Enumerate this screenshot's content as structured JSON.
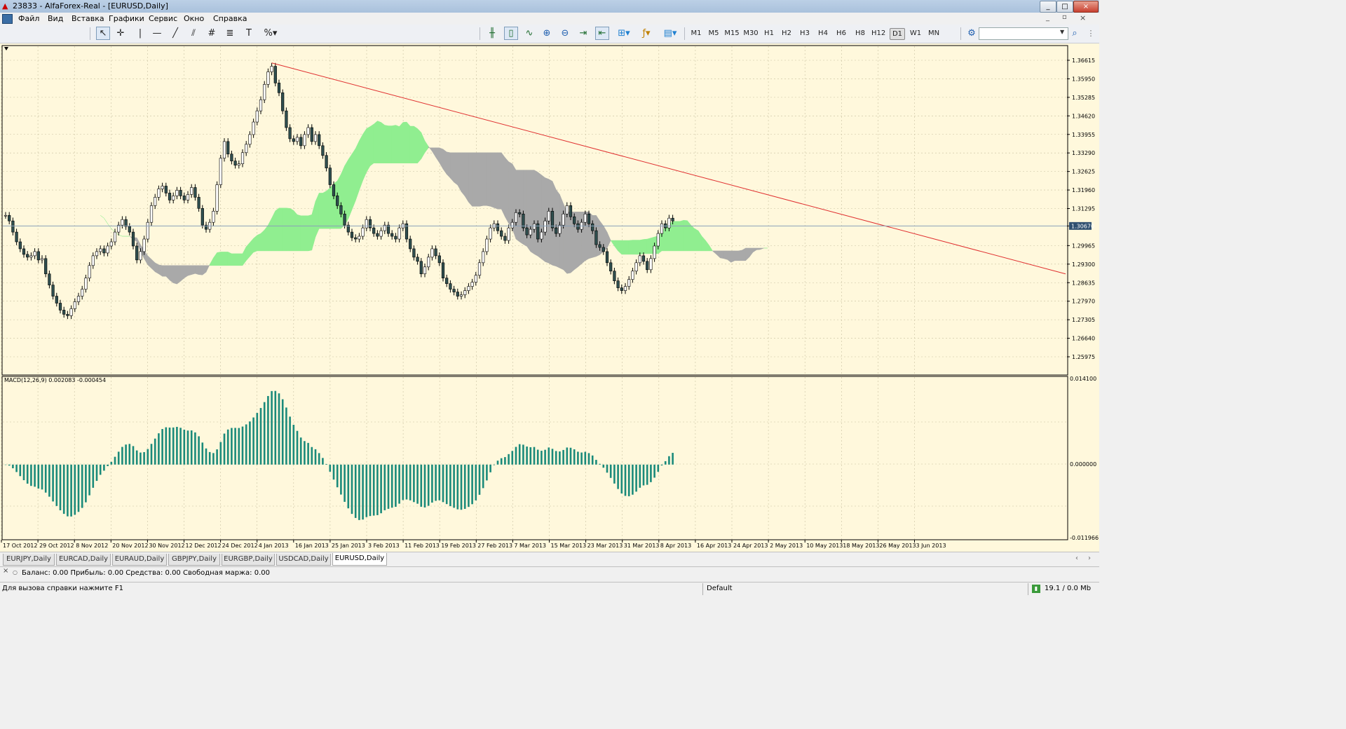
{
  "window": {
    "title": "23833 - AlfaForex-Real - [EURUSD,Daily]",
    "controls": [
      "_",
      "□",
      "×"
    ]
  },
  "menu": [
    "Файл",
    "Вид",
    "Вставка",
    "Графики",
    "Сервис",
    "Окно",
    "Справка"
  ],
  "timeframes": [
    "M1",
    "M5",
    "M15",
    "M30",
    "H1",
    "H2",
    "H3",
    "H4",
    "H6",
    "H8",
    "H12",
    "D1",
    "W1",
    "MN"
  ],
  "active_timeframe": "D1",
  "search": {
    "value": ""
  },
  "chart": {
    "symbol": "EURUSD",
    "period": "Daily",
    "current_price": "1.30670",
    "price_labels": [
      "1.36615",
      "1.35950",
      "1.35285",
      "1.34620",
      "1.33955",
      "1.33290",
      "1.32625",
      "1.31960",
      "1.31295",
      "1.30670",
      "1.29965",
      "1.29300",
      "1.28635",
      "1.27970",
      "1.27305",
      "1.26640",
      "1.25975"
    ],
    "indicator_title": "MACD(12,26,9) 0.002083 -0.000454",
    "indicator_scale": [
      "0.014100",
      "0.000000",
      "-0.011966"
    ],
    "date_labels": [
      "17 Oct 2012",
      "29 Oct 2012",
      "8 Nov 2012",
      "20 Nov 2012",
      "30 Nov 2012",
      "12 Dec 2012",
      "24 Dec 2012",
      "4 Jan 2013",
      "16 Jan 2013",
      "25 Jan 2013",
      "3 Feb 2013",
      "11 Feb 2013",
      "19 Feb 2013",
      "27 Feb 2013",
      "7 Mar 2013",
      "15 Mar 2013",
      "23 Mar 2013",
      "31 Mar 2013",
      "8 Apr 2013",
      "16 Apr 2013",
      "24 Apr 2013",
      "2 May 2013",
      "10 May 2013",
      "18 May 2013",
      "26 May 2013",
      "3 Jun 2013"
    ],
    "colors": {
      "background": "#fff8dc",
      "grid": "#c8c0a0",
      "bull_candle": "#ffffff",
      "bear_candle": "#2f4f4f",
      "cloud_bull": "#90ee90",
      "cloud_bear": "#a9a9a9",
      "trendline": "#e03030",
      "macd": "#1a8a7a"
    },
    "close_prices": [
      1.3105,
      1.3085,
      1.3045,
      1.301,
      1.2985,
      1.2965,
      1.2955,
      1.296,
      1.2975,
      1.2945,
      1.295,
      1.2895,
      1.2855,
      1.2815,
      1.279,
      1.2765,
      1.275,
      1.2745,
      1.277,
      1.2795,
      1.2815,
      1.284,
      1.288,
      1.2925,
      1.296,
      1.2975,
      1.2985,
      1.297,
      1.2995,
      1.301,
      1.3045,
      1.307,
      1.309,
      1.3065,
      1.3045,
      1.2995,
      1.2945,
      1.2975,
      1.302,
      1.308,
      1.314,
      1.317,
      1.32,
      1.321,
      1.3185,
      1.316,
      1.3175,
      1.3195,
      1.3175,
      1.316,
      1.318,
      1.3205,
      1.317,
      1.313,
      1.307,
      1.3055,
      1.308,
      1.312,
      1.3215,
      1.331,
      1.337,
      1.3325,
      1.33,
      1.3285,
      1.329,
      1.333,
      1.336,
      1.3395,
      1.344,
      1.348,
      1.352,
      1.3575,
      1.362,
      1.364,
      1.358,
      1.3545,
      1.348,
      1.342,
      1.338,
      1.337,
      1.3385,
      1.3355,
      1.3395,
      1.342,
      1.337,
      1.3395,
      1.3355,
      1.332,
      1.3275,
      1.3215,
      1.3175,
      1.314,
      1.311,
      1.307,
      1.3045,
      1.3025,
      1.302,
      1.303,
      1.306,
      1.309,
      1.306,
      1.304,
      1.303,
      1.305,
      1.307,
      1.304,
      1.303,
      1.302,
      1.306,
      1.3075,
      1.302,
      1.2985,
      1.2955,
      1.294,
      1.2895,
      1.292,
      1.2955,
      1.2985,
      1.296,
      1.2935,
      1.288,
      1.286,
      1.284,
      1.283,
      1.2815,
      1.282,
      1.2835,
      1.285,
      1.2865,
      1.289,
      1.2935,
      1.2975,
      1.302,
      1.306,
      1.3075,
      1.305,
      1.303,
      1.3015,
      1.306,
      1.308,
      1.3115,
      1.311,
      1.306,
      1.3035,
      1.3055,
      1.3075,
      1.302,
      1.3045,
      1.3085,
      1.312,
      1.306,
      1.304,
      1.307,
      1.311,
      1.314,
      1.31,
      1.3075,
      1.3055,
      1.308,
      1.311,
      1.3075,
      1.305,
      1.3,
      1.299,
      1.2975,
      1.2935,
      1.2905,
      1.287,
      1.2845,
      1.2835,
      1.285,
      1.2875,
      1.2905,
      1.2935,
      1.296,
      1.294,
      1.291,
      1.295,
      1.2995,
      1.304,
      1.3075,
      1.306,
      1.3095,
      1.3085
    ]
  },
  "symbol_tabs": [
    "EURJPY,Daily",
    "EURCAD,Daily",
    "EURAUD,Daily",
    "GBPJPY,Daily",
    "EURGBP,Daily",
    "USDCAD,Daily",
    "EURUSD,Daily"
  ],
  "active_symbol_tab": "EURUSD,Daily",
  "terminal": {
    "text": "Баланс: 0.00  Прибыль: 0.00  Средства: 0.00  Свободная маржа: 0.00"
  },
  "status": {
    "help": "Для вызова справки нажмите F1",
    "profile": "Default",
    "traffic": "19.1 / 0.0 Mb"
  }
}
